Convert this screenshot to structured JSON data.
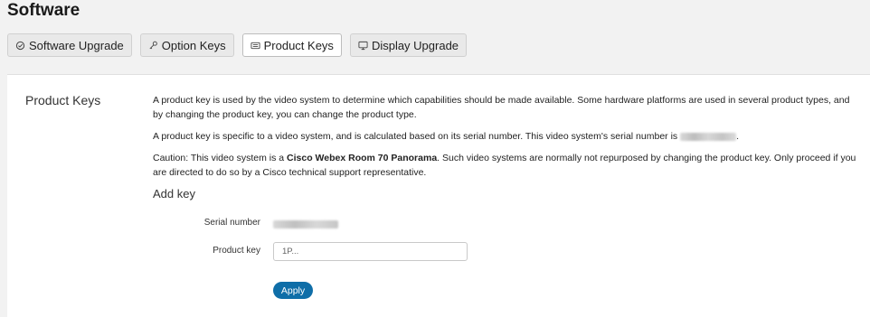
{
  "page_title": "Software",
  "tabs": [
    {
      "label": "Software Upgrade",
      "icon": "upgrade-icon",
      "active": false
    },
    {
      "label": "Option Keys",
      "icon": "key-icon",
      "active": false
    },
    {
      "label": "Product Keys",
      "icon": "keyboard-icon",
      "active": true
    },
    {
      "label": "Display Upgrade",
      "icon": "display-icon",
      "active": false
    }
  ],
  "panel": {
    "section_title": "Product Keys",
    "para1": "A product key is used by the video system to determine which capabilities should be made available. Some hardware platforms are used in several product types, and by changing the product key, you can change the product type.",
    "para2_before": "A product key is specific to a video system, and is calculated based on its serial number. This video system's serial number is",
    "para2_after": ".",
    "caution_before": "Caution: This video system is a",
    "caution_bold": "Cisco Webex Room 70 Panorama",
    "caution_after": ". Such video systems are normally not repurposed by changing the product key. Only proceed if you are directed to do so by a Cisco technical support representative.",
    "add_key_title": "Add key",
    "serial_label": "Serial number",
    "product_key_label": "Product key",
    "product_key_placeholder": "1P...",
    "product_key_value": "",
    "apply_label": "Apply"
  },
  "colors": {
    "accent": "#0f6ea8",
    "background": "#f2f2f2",
    "panel": "#ffffff"
  }
}
